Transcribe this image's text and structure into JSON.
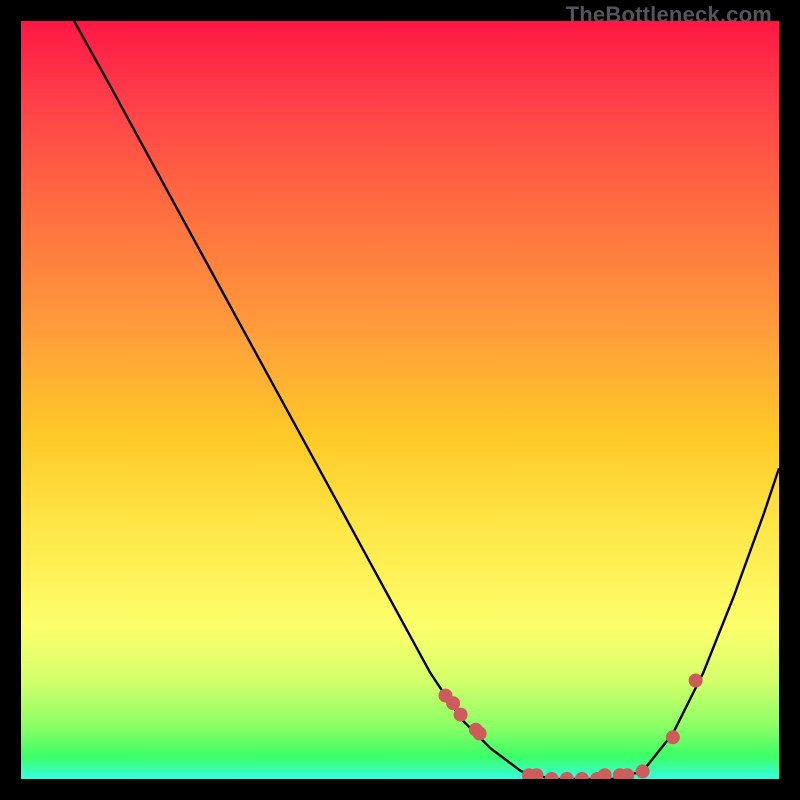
{
  "watermark": "TheBottleneck.com",
  "chart_data": {
    "type": "line",
    "title": "",
    "xlabel": "",
    "ylabel": "",
    "xlim": [
      0,
      100
    ],
    "ylim": [
      0,
      100
    ],
    "curve": {
      "name": "bottleneck-curve",
      "x": [
        7,
        12,
        18,
        24,
        30,
        36,
        42,
        48,
        54,
        58,
        62,
        66,
        70,
        74,
        78,
        82,
        86,
        90,
        94,
        98,
        100
      ],
      "y": [
        100,
        91,
        80,
        69,
        58,
        47,
        36,
        25,
        14,
        8,
        4,
        1,
        0,
        0,
        0,
        1,
        6,
        14,
        24,
        35,
        41
      ]
    },
    "markers": {
      "name": "highlight-points",
      "x": [
        56,
        57,
        58,
        60,
        60.5,
        67,
        68,
        70,
        72,
        74,
        76,
        77,
        79,
        80,
        82,
        86,
        89
      ],
      "y": [
        11,
        10,
        8.5,
        6.5,
        6,
        0.5,
        0.5,
        0,
        0,
        0,
        0,
        0.5,
        0.5,
        0.5,
        1,
        5.5,
        13
      ]
    },
    "marker_style": {
      "color": "#cd5c5c",
      "radius_px": 7
    }
  }
}
